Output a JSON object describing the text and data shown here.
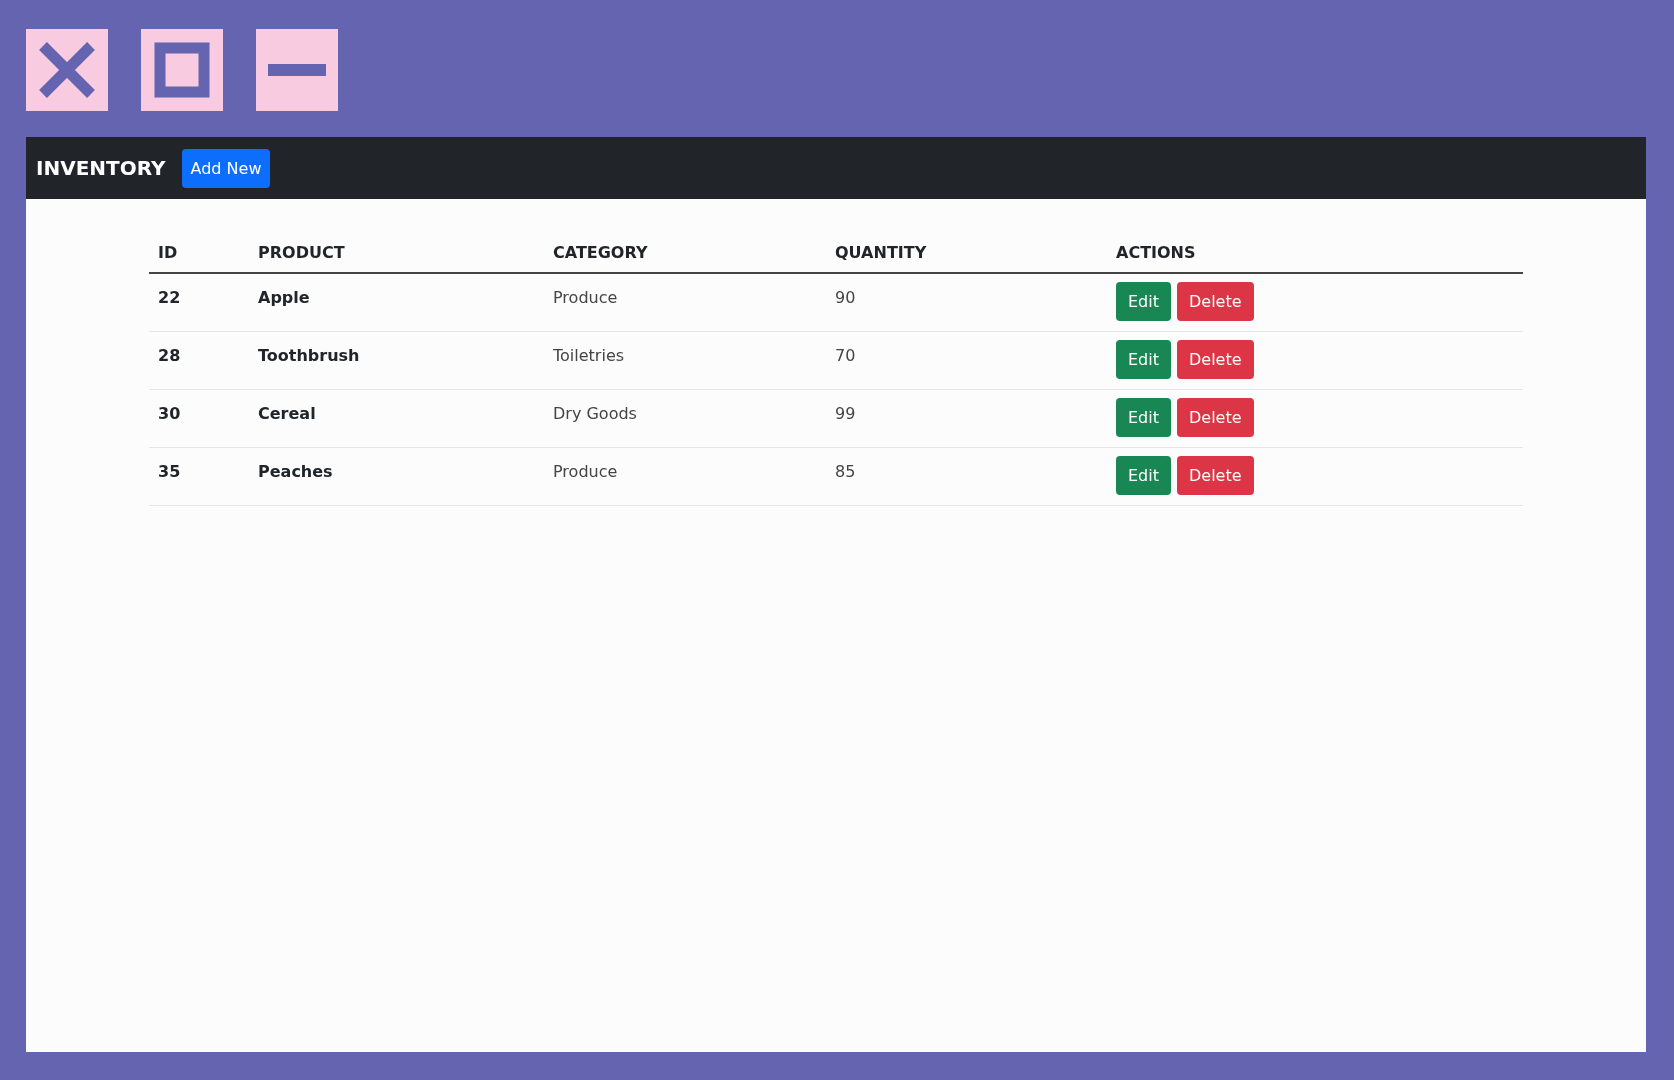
{
  "window_controls": [
    {
      "kind": "close"
    },
    {
      "kind": "maximize"
    },
    {
      "kind": "minimize"
    }
  ],
  "navbar": {
    "brand": "INVENTORY",
    "add_button": "Add New"
  },
  "table": {
    "columns": [
      "ID",
      "PRODUCT",
      "CATEGORY",
      "QUANTITY",
      "ACTIONS"
    ],
    "rows": [
      {
        "id": "22",
        "product": "Apple",
        "category": "Produce",
        "quantity": "90",
        "actions": [
          {
            "label": "Edit",
            "kind": "edit"
          },
          {
            "label": "Delete",
            "kind": "delete"
          }
        ]
      },
      {
        "id": "28",
        "product": "Toothbrush",
        "category": "Toiletries",
        "quantity": "70",
        "actions": [
          {
            "label": "Edit",
            "kind": "edit"
          },
          {
            "label": "Delete",
            "kind": "delete"
          }
        ]
      },
      {
        "id": "30",
        "product": "Cereal",
        "category": "Dry Goods",
        "quantity": "99",
        "actions": [
          {
            "label": "Edit",
            "kind": "edit"
          },
          {
            "label": "Delete",
            "kind": "delete"
          }
        ]
      },
      {
        "id": "35",
        "product": "Peaches",
        "category": "Produce",
        "quantity": "85",
        "actions": [
          {
            "label": "Edit",
            "kind": "edit"
          },
          {
            "label": "Delete",
            "kind": "delete"
          }
        ]
      }
    ]
  }
}
